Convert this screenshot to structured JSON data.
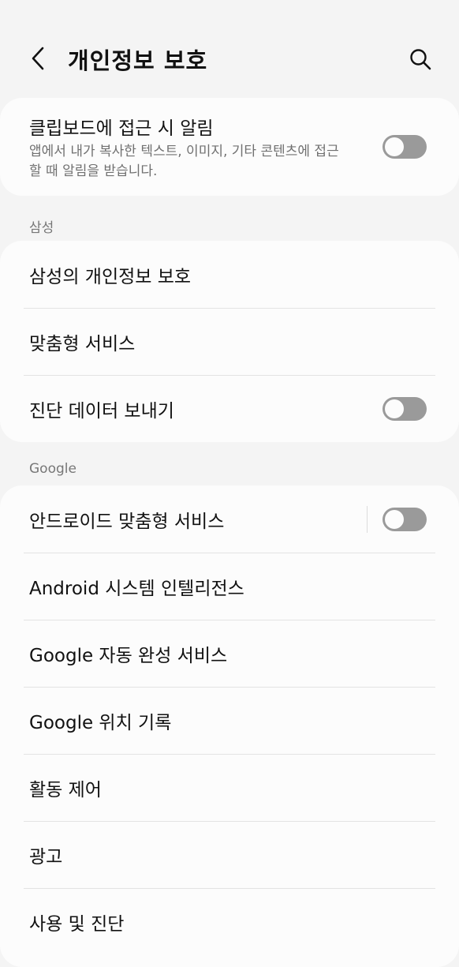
{
  "header": {
    "back_icon": "chevron-left-icon",
    "title": "개인정보 보호",
    "search_icon": "search-icon"
  },
  "clipboard": {
    "title": "클립보드에 접근 시 알림",
    "description": "앱에서 내가 복사한 텍스트, 이미지, 기타 콘텐츠에 접근할 때 알림을 받습니다.",
    "toggle_on": false
  },
  "samsung": {
    "header": "삼성",
    "items": [
      {
        "label": "삼성의 개인정보 보호",
        "has_toggle": false
      },
      {
        "label": "맞춤형 서비스",
        "has_toggle": false
      },
      {
        "label": "진단 데이터 보내기",
        "has_toggle": true,
        "toggle_on": false
      }
    ]
  },
  "google": {
    "header": "Google",
    "items": [
      {
        "label": "안드로이드 맞춤형 서비스",
        "has_toggle": true,
        "toggle_on": false
      },
      {
        "label": "Android 시스템 인텔리전스",
        "has_toggle": false
      },
      {
        "label": "Google 자동 완성 서비스",
        "has_toggle": false
      },
      {
        "label": "Google 위치 기록",
        "has_toggle": false
      },
      {
        "label": "활동 제어",
        "has_toggle": false
      },
      {
        "label": "광고",
        "has_toggle": false
      },
      {
        "label": "사용 및 진단",
        "has_toggle": false
      }
    ]
  },
  "colors": {
    "background": "#f4f4f4",
    "card": "#fcfcfc",
    "toggle_off_track": "#9a9a9a",
    "section_header": "#777777"
  }
}
